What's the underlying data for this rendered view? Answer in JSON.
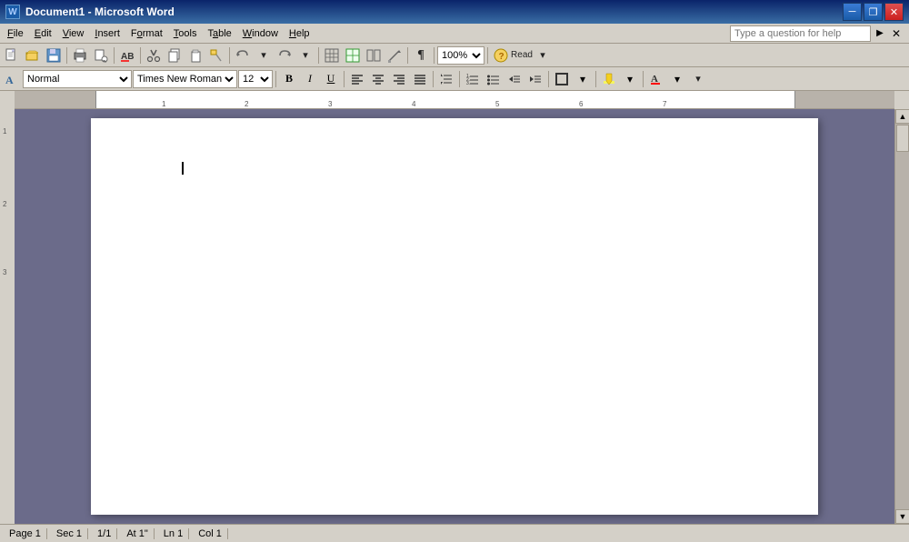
{
  "titleBar": {
    "title": "Document1 - Microsoft Word",
    "icon": "W",
    "minimizeLabel": "─",
    "restoreLabel": "❐",
    "closeLabel": "✕"
  },
  "menuBar": {
    "items": [
      {
        "label": "File",
        "underline": "F"
      },
      {
        "label": "Edit",
        "underline": "E"
      },
      {
        "label": "View",
        "underline": "V"
      },
      {
        "label": "Insert",
        "underline": "I"
      },
      {
        "label": "Format",
        "underline": "o"
      },
      {
        "label": "Tools",
        "underline": "T"
      },
      {
        "label": "Table",
        "underline": "a"
      },
      {
        "label": "Window",
        "underline": "W"
      },
      {
        "label": "Help",
        "underline": "H"
      }
    ],
    "helpPlaceholder": "Type a question for help"
  },
  "toolbar1": {
    "zoom": "100%",
    "readLabel": "Read"
  },
  "formatBar": {
    "style": "Normal",
    "font": "Times New Roman",
    "size": "12",
    "boldLabel": "B",
    "italicLabel": "I",
    "underlineLabel": "U"
  },
  "statusBar": {
    "page": "Page 1",
    "sec": "Sec 1",
    "pageOf": "1/1",
    "at": "At 1\"",
    "ln": "Ln 1",
    "col": "Col 1"
  },
  "document": {
    "content": ""
  }
}
